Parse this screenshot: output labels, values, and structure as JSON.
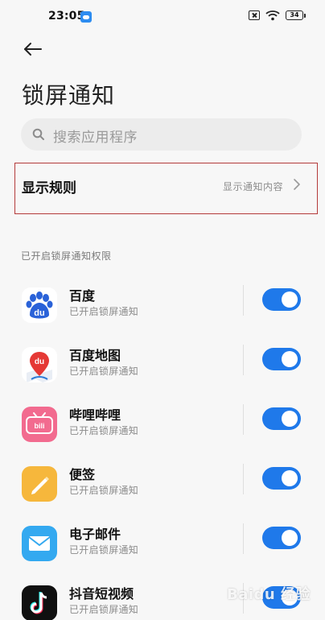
{
  "status_bar": {
    "time": "23:05",
    "battery": "34",
    "icons": [
      "app-notification-icon",
      "sim-off-icon",
      "wifi-icon",
      "battery-icon"
    ]
  },
  "header": {
    "title": "锁屏通知",
    "back_icon": "arrow-left-icon"
  },
  "search": {
    "placeholder": "搜索应用程序"
  },
  "rule": {
    "label": "显示规则",
    "value": "显示通知内容"
  },
  "section": {
    "label": "已开启锁屏通知权限"
  },
  "apps": [
    {
      "name": "百度",
      "status": "已开启锁屏通知",
      "enabled": true,
      "icon": "baidu-icon"
    },
    {
      "name": "百度地图",
      "status": "已开启锁屏通知",
      "enabled": true,
      "icon": "baidu-map-icon"
    },
    {
      "name": "哔哩哔哩",
      "status": "已开启锁屏通知",
      "enabled": true,
      "icon": "bilibili-icon"
    },
    {
      "name": "便签",
      "status": "已开启锁屏通知",
      "enabled": true,
      "icon": "notes-icon"
    },
    {
      "name": "电子邮件",
      "status": "已开启锁屏通知",
      "enabled": true,
      "icon": "mail-icon"
    },
    {
      "name": "抖音短视频",
      "status": "已开启锁屏通知",
      "enabled": true,
      "icon": "tiktok-icon"
    }
  ],
  "watermark": "Baidu 经验",
  "colors": {
    "toggle_on": "#1f79ea",
    "highlight_border": "#b43a3a",
    "background": "#f7f7f7"
  }
}
